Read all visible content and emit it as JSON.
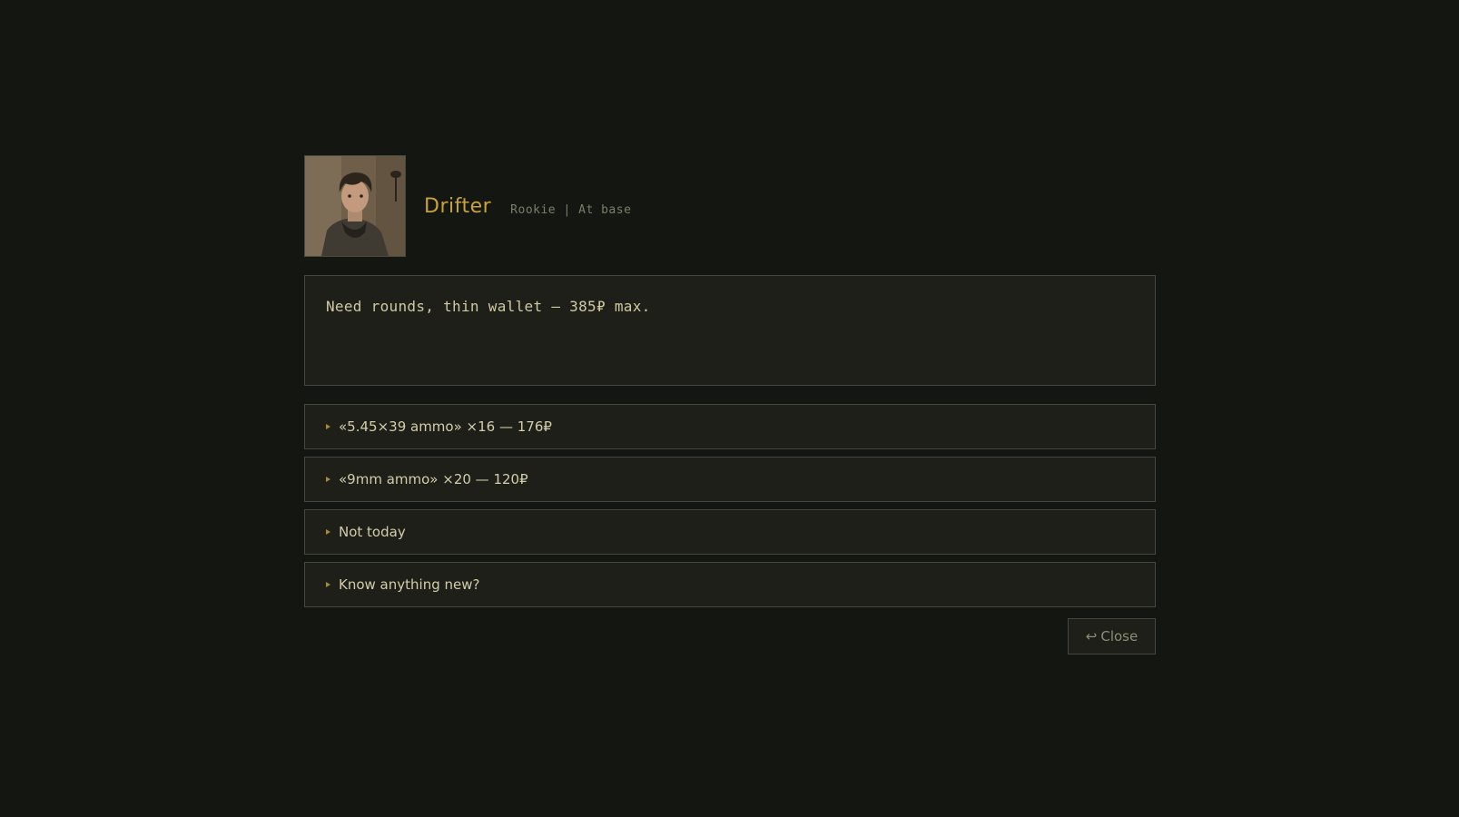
{
  "npc": {
    "name": "Drifter",
    "meta": "Rookie | At base",
    "portrait_icon": "character-portrait"
  },
  "speech": {
    "text": "Need rounds, thin wallet — 385₽ max."
  },
  "options": [
    {
      "label": "«5.45×39 ammo» ×16 — 176₽"
    },
    {
      "label": "«9mm ammo» ×20 — 120₽"
    },
    {
      "label": "Not today"
    },
    {
      "label": "Know anything new?"
    }
  ],
  "footer": {
    "close_glyph": "↩",
    "close_label": "Close"
  },
  "colors": {
    "background": "#131611",
    "panel": "#1d1f18",
    "border": "#46473b",
    "accent": "#c9a23a",
    "text": "#d0c9a4"
  }
}
